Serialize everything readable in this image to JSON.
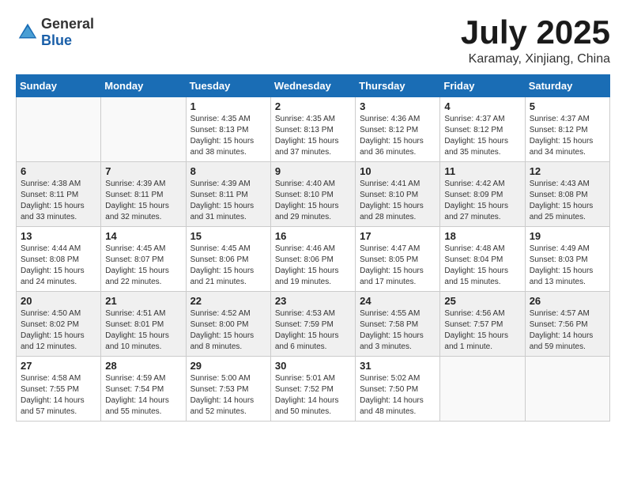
{
  "header": {
    "logo_general": "General",
    "logo_blue": "Blue",
    "title": "July 2025",
    "location": "Karamay, Xinjiang, China"
  },
  "days_of_week": [
    "Sunday",
    "Monday",
    "Tuesday",
    "Wednesday",
    "Thursday",
    "Friday",
    "Saturday"
  ],
  "weeks": [
    [
      {
        "day": "",
        "info": ""
      },
      {
        "day": "",
        "info": ""
      },
      {
        "day": "1",
        "info": "Sunrise: 4:35 AM\nSunset: 8:13 PM\nDaylight: 15 hours and 38 minutes."
      },
      {
        "day": "2",
        "info": "Sunrise: 4:35 AM\nSunset: 8:13 PM\nDaylight: 15 hours and 37 minutes."
      },
      {
        "day": "3",
        "info": "Sunrise: 4:36 AM\nSunset: 8:12 PM\nDaylight: 15 hours and 36 minutes."
      },
      {
        "day": "4",
        "info": "Sunrise: 4:37 AM\nSunset: 8:12 PM\nDaylight: 15 hours and 35 minutes."
      },
      {
        "day": "5",
        "info": "Sunrise: 4:37 AM\nSunset: 8:12 PM\nDaylight: 15 hours and 34 minutes."
      }
    ],
    [
      {
        "day": "6",
        "info": "Sunrise: 4:38 AM\nSunset: 8:11 PM\nDaylight: 15 hours and 33 minutes."
      },
      {
        "day": "7",
        "info": "Sunrise: 4:39 AM\nSunset: 8:11 PM\nDaylight: 15 hours and 32 minutes."
      },
      {
        "day": "8",
        "info": "Sunrise: 4:39 AM\nSunset: 8:11 PM\nDaylight: 15 hours and 31 minutes."
      },
      {
        "day": "9",
        "info": "Sunrise: 4:40 AM\nSunset: 8:10 PM\nDaylight: 15 hours and 29 minutes."
      },
      {
        "day": "10",
        "info": "Sunrise: 4:41 AM\nSunset: 8:10 PM\nDaylight: 15 hours and 28 minutes."
      },
      {
        "day": "11",
        "info": "Sunrise: 4:42 AM\nSunset: 8:09 PM\nDaylight: 15 hours and 27 minutes."
      },
      {
        "day": "12",
        "info": "Sunrise: 4:43 AM\nSunset: 8:08 PM\nDaylight: 15 hours and 25 minutes."
      }
    ],
    [
      {
        "day": "13",
        "info": "Sunrise: 4:44 AM\nSunset: 8:08 PM\nDaylight: 15 hours and 24 minutes."
      },
      {
        "day": "14",
        "info": "Sunrise: 4:45 AM\nSunset: 8:07 PM\nDaylight: 15 hours and 22 minutes."
      },
      {
        "day": "15",
        "info": "Sunrise: 4:45 AM\nSunset: 8:06 PM\nDaylight: 15 hours and 21 minutes."
      },
      {
        "day": "16",
        "info": "Sunrise: 4:46 AM\nSunset: 8:06 PM\nDaylight: 15 hours and 19 minutes."
      },
      {
        "day": "17",
        "info": "Sunrise: 4:47 AM\nSunset: 8:05 PM\nDaylight: 15 hours and 17 minutes."
      },
      {
        "day": "18",
        "info": "Sunrise: 4:48 AM\nSunset: 8:04 PM\nDaylight: 15 hours and 15 minutes."
      },
      {
        "day": "19",
        "info": "Sunrise: 4:49 AM\nSunset: 8:03 PM\nDaylight: 15 hours and 13 minutes."
      }
    ],
    [
      {
        "day": "20",
        "info": "Sunrise: 4:50 AM\nSunset: 8:02 PM\nDaylight: 15 hours and 12 minutes."
      },
      {
        "day": "21",
        "info": "Sunrise: 4:51 AM\nSunset: 8:01 PM\nDaylight: 15 hours and 10 minutes."
      },
      {
        "day": "22",
        "info": "Sunrise: 4:52 AM\nSunset: 8:00 PM\nDaylight: 15 hours and 8 minutes."
      },
      {
        "day": "23",
        "info": "Sunrise: 4:53 AM\nSunset: 7:59 PM\nDaylight: 15 hours and 6 minutes."
      },
      {
        "day": "24",
        "info": "Sunrise: 4:55 AM\nSunset: 7:58 PM\nDaylight: 15 hours and 3 minutes."
      },
      {
        "day": "25",
        "info": "Sunrise: 4:56 AM\nSunset: 7:57 PM\nDaylight: 15 hours and 1 minute."
      },
      {
        "day": "26",
        "info": "Sunrise: 4:57 AM\nSunset: 7:56 PM\nDaylight: 14 hours and 59 minutes."
      }
    ],
    [
      {
        "day": "27",
        "info": "Sunrise: 4:58 AM\nSunset: 7:55 PM\nDaylight: 14 hours and 57 minutes."
      },
      {
        "day": "28",
        "info": "Sunrise: 4:59 AM\nSunset: 7:54 PM\nDaylight: 14 hours and 55 minutes."
      },
      {
        "day": "29",
        "info": "Sunrise: 5:00 AM\nSunset: 7:53 PM\nDaylight: 14 hours and 52 minutes."
      },
      {
        "day": "30",
        "info": "Sunrise: 5:01 AM\nSunset: 7:52 PM\nDaylight: 14 hours and 50 minutes."
      },
      {
        "day": "31",
        "info": "Sunrise: 5:02 AM\nSunset: 7:50 PM\nDaylight: 14 hours and 48 minutes."
      },
      {
        "day": "",
        "info": ""
      },
      {
        "day": "",
        "info": ""
      }
    ]
  ]
}
